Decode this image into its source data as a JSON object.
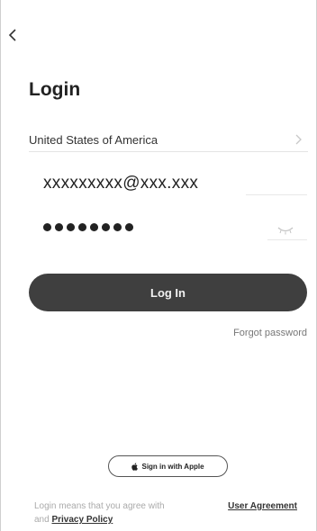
{
  "header": {
    "back_icon": "chevron-left-icon",
    "title": "Login"
  },
  "form": {
    "country_label": "United States of America",
    "country_icon": "chevron-right-icon",
    "email_value": "xxxxxxxxx@xxx.xxx",
    "password_mask_count": 8,
    "password_toggle_icon": "eye-closed-icon",
    "login_button_label": "Log In",
    "forgot_password_label": "Forgot password"
  },
  "footer": {
    "apple_icon": "apple-logo-icon",
    "apple_button_label": "Sign in with Apple",
    "terms_prefix": "Login means that you agree with",
    "user_agreement_label": "User Agreement",
    "terms_and": "and",
    "privacy_policy_label": "Privacy Policy"
  },
  "colors": {
    "button_bg": "#3f3f3f",
    "background": "#ffffff",
    "text_primary": "#222222",
    "text_muted": "#aaaaaa"
  }
}
